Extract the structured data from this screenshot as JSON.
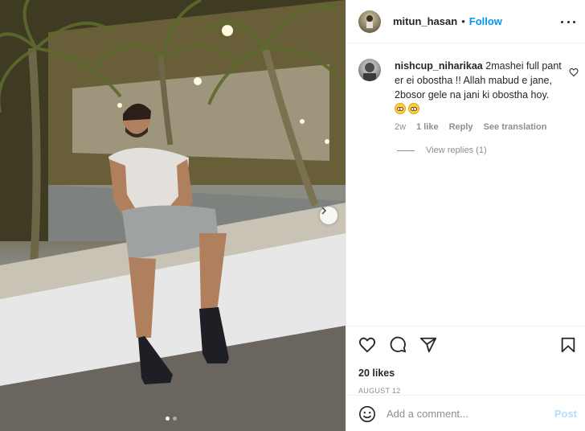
{
  "photo": {
    "alt_semantic": "man sitting on a wall at night under palm trees",
    "carousel_dots": 2,
    "active_dot": 0
  },
  "header": {
    "username": "mitun_hasan",
    "separator": "•",
    "follow_label": "Follow"
  },
  "comment": {
    "username": "nishcup_niharikaa",
    "text": "2mashei full pant er ei obostha !! Allah mabud e jane, 2bosor gele na jani ki obostha hoy.",
    "emojis": [
      "flushed-face",
      "flushed-face"
    ],
    "time": "2w",
    "likes": "1 like",
    "reply_label": "Reply",
    "translate_label": "See translation",
    "view_replies": "View replies (1)"
  },
  "actions": {
    "likes": "20 likes",
    "date": "AUGUST 12"
  },
  "composer": {
    "placeholder": "Add a comment...",
    "post_label": "Post"
  },
  "colors": {
    "accent": "#0095f6",
    "post_disabled": "#b2dffc",
    "muted": "#8e8e8e",
    "text": "#262626"
  }
}
